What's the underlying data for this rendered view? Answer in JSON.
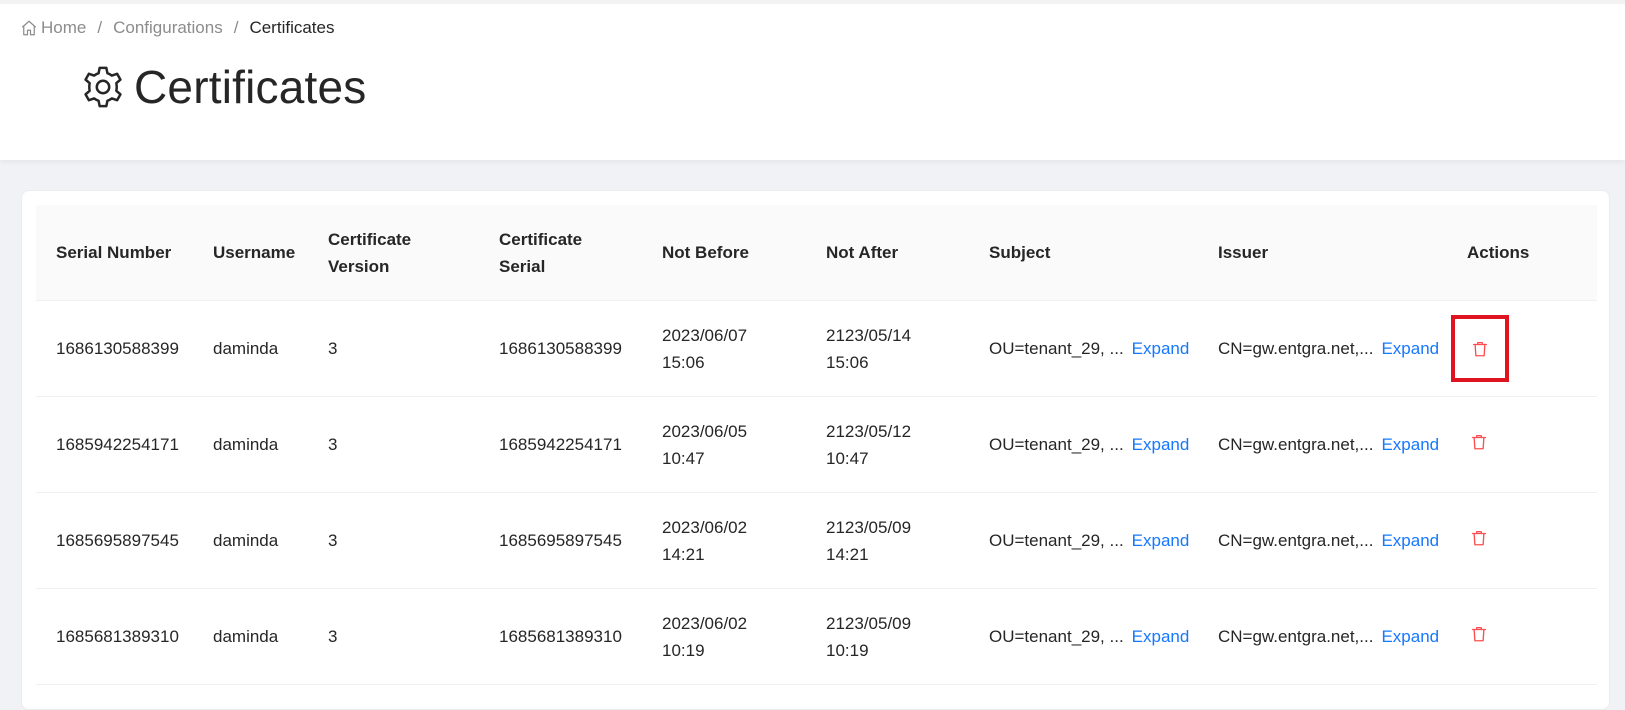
{
  "breadcrumb": {
    "home": "Home",
    "configurations": "Configurations",
    "current": "Certificates",
    "separator": "/"
  },
  "page": {
    "title": "Certificates"
  },
  "table": {
    "columns": [
      "Serial Number",
      "Username",
      "Certificate Version",
      "Certificate Serial",
      "Not Before",
      "Not After",
      "Subject",
      "Issuer",
      "Actions"
    ],
    "expand_label": "Expand",
    "rows": [
      {
        "serial_number": "1686130588399",
        "username": "daminda",
        "version": "3",
        "certificate_serial": "1686130588399",
        "not_before_date": "2023/06/07",
        "not_before_time": "15:06",
        "not_after_date": "2123/05/14",
        "not_after_time": "15:06",
        "subject": "OU=tenant_29, ...",
        "issuer": "CN=gw.entgra.net,..."
      },
      {
        "serial_number": "1685942254171",
        "username": "daminda",
        "version": "3",
        "certificate_serial": "1685942254171",
        "not_before_date": "2023/06/05",
        "not_before_time": "10:47",
        "not_after_date": "2123/05/12",
        "not_after_time": "10:47",
        "subject": "OU=tenant_29, ...",
        "issuer": "CN=gw.entgra.net,..."
      },
      {
        "serial_number": "1685695897545",
        "username": "daminda",
        "version": "3",
        "certificate_serial": "1685695897545",
        "not_before_date": "2023/06/02",
        "not_before_time": "14:21",
        "not_after_date": "2123/05/09",
        "not_after_time": "14:21",
        "subject": "OU=tenant_29, ...",
        "issuer": "CN=gw.entgra.net,..."
      },
      {
        "serial_number": "1685681389310",
        "username": "daminda",
        "version": "3",
        "certificate_serial": "1685681389310",
        "not_before_date": "2023/06/02",
        "not_before_time": "10:19",
        "not_after_date": "2123/05/09",
        "not_after_time": "10:19",
        "subject": "OU=tenant_29, ...",
        "issuer": "CN=gw.entgra.net,..."
      }
    ]
  },
  "icons": {
    "home": "home-icon",
    "gear": "gear-icon",
    "delete": "trash-icon"
  },
  "colors": {
    "link": "#1677ff",
    "danger": "#ff4d4f",
    "highlight": "#e0141e"
  }
}
